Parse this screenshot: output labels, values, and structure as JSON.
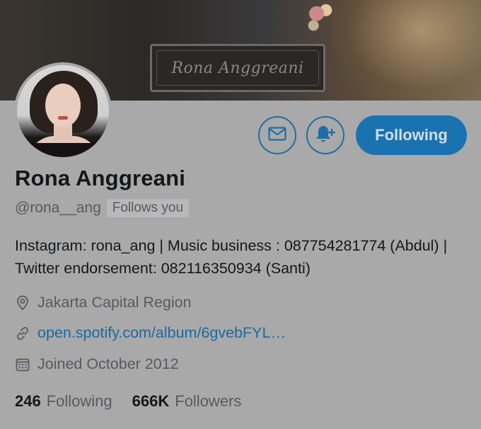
{
  "banner": {
    "plaque_text": "Rona Anggreani"
  },
  "profile": {
    "display_name": "Rona Anggreani",
    "handle": "@rona__ang",
    "follows_you": "Follows you",
    "bio": "Instagram: rona_ang | Music business : 087754281774 (Abdul) | Twitter endorsement: 082116350934 (Santi)",
    "location": "Jakarta Capital Region",
    "link": "open.spotify.com/album/6gvebFYL…",
    "joined": "Joined October 2012"
  },
  "actions": {
    "message_icon": "envelope-icon",
    "notify_icon": "bell-plus-icon",
    "following_label": "Following"
  },
  "stats": {
    "following_count": "246",
    "following_label": "Following",
    "followers_count": "666K",
    "followers_label": "Followers"
  },
  "colors": {
    "accent": "#1a73b0",
    "background": "#a9a9a9",
    "link": "#1a6aa0"
  }
}
